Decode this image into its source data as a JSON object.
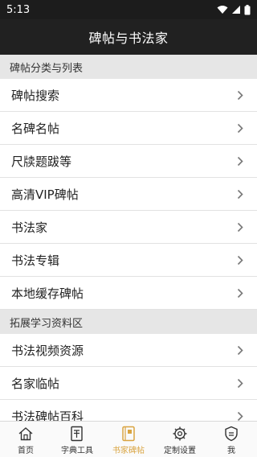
{
  "status_bar": {
    "time": "5:13"
  },
  "header": {
    "title": "碑帖与书法家"
  },
  "sections": [
    {
      "title": "碑帖分类与列表",
      "items": [
        {
          "label": "碑帖搜索"
        },
        {
          "label": "名碑名帖"
        },
        {
          "label": "尺牍题跋等"
        },
        {
          "label": "高清VIP碑帖"
        },
        {
          "label": "书法家"
        },
        {
          "label": "书法专辑"
        },
        {
          "label": "本地缓存碑帖"
        }
      ]
    },
    {
      "title": "拓展学习资料区",
      "items": [
        {
          "label": "书法视频资源"
        },
        {
          "label": "名家临帖"
        },
        {
          "label": "书法碑帖百科"
        }
      ]
    }
  ],
  "tabs": [
    {
      "label": "首页",
      "icon": "home-icon"
    },
    {
      "label": "字典工具",
      "icon": "dictionary-icon"
    },
    {
      "label": "书家碑帖",
      "icon": "book-icon",
      "active": true
    },
    {
      "label": "定制设置",
      "icon": "gear-icon"
    },
    {
      "label": "我",
      "icon": "user-icon"
    }
  ],
  "colors": {
    "active_tab": "#d9a441",
    "header_bg": "#212121",
    "section_bg": "#e6e6e6"
  }
}
